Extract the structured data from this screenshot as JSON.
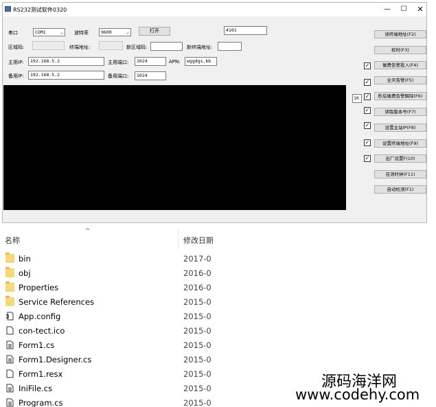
{
  "window": {
    "title": "RS232测试软件0320",
    "min_glyph": "—",
    "max_glyph": "☐",
    "close_glyph": "✕"
  },
  "form": {
    "serial_label": "串口",
    "serial_value": "COM1",
    "baud_label": "波特率",
    "baud_value": "9600",
    "open_button": "打开",
    "top_field_value": "4101",
    "zone_label": "区域码:",
    "zone_value": "",
    "terminal_label": "终端地址:",
    "terminal_value": "",
    "new_zone_label": "新区域码:",
    "new_zone_value": "",
    "new_terminal_label": "新终端地址:",
    "new_terminal_value": "",
    "main_ip_label": "主用IP:",
    "main_ip_value": "192.168.5.2",
    "main_port_label": "主用端口:",
    "main_port_value": "1024",
    "apn_label": "APN:",
    "apn_value": "wggdgs.bb",
    "backup_ip_label": "备用IP:",
    "backup_ip_value": "192.168.5.2",
    "backup_port_label": "备用端口:",
    "backup_port_value": "1024",
    "delay_value": "10"
  },
  "side_buttons": [
    {
      "label": "读终端地址(F2)",
      "checkbox": false,
      "checked": false
    },
    {
      "label": "校时(F3)",
      "checkbox": false,
      "checked": false
    },
    {
      "label": "催费告警投入(F4)",
      "checkbox": true,
      "checked": true
    },
    {
      "label": "全天告警(F5)",
      "checkbox": true,
      "checked": true
    },
    {
      "label": "秒后催费告警解除(F6)",
      "checkbox": true,
      "checked": true
    },
    {
      "label": "读取版本号(F7)",
      "checkbox": true,
      "checked": true
    },
    {
      "label": "设置主站IP(F8)",
      "checkbox": true,
      "checked": true
    },
    {
      "label": "设置终端地址(F9)",
      "checkbox": true,
      "checked": true
    },
    {
      "label": "出厂设置F(10)",
      "checkbox": true,
      "checked": true
    },
    {
      "label": "召测时钟(F11)",
      "checkbox": false,
      "checked": false
    },
    {
      "label": "自动检测(F1)",
      "checkbox": false,
      "checked": false
    }
  ],
  "explorer": {
    "sort_arrow": "^",
    "col_name": "名称",
    "col_date": "修改日期",
    "files": [
      {
        "name": "bin",
        "date": "2017-0",
        "icon": "folder-icon"
      },
      {
        "name": "obj",
        "date": "2016-0",
        "icon": "folder-icon"
      },
      {
        "name": "Properties",
        "date": "2016-0",
        "icon": "folder-icon"
      },
      {
        "name": "Service References",
        "date": "2015-0",
        "icon": "folder-icon"
      },
      {
        "name": "App.config",
        "date": "2015-0",
        "icon": "config-file-icon"
      },
      {
        "name": "con-tect.ico",
        "date": "2015-0",
        "icon": "blank-file-icon"
      },
      {
        "name": "Form1.cs",
        "date": "2015-0",
        "icon": "text-file-icon"
      },
      {
        "name": "Form1.Designer.cs",
        "date": "2015-0",
        "icon": "text-file-icon"
      },
      {
        "name": "Form1.resx",
        "date": "2015-0",
        "icon": "blank-file-icon"
      },
      {
        "name": "IniFile.cs",
        "date": "2015-0",
        "icon": "text-file-icon"
      },
      {
        "name": "Program.cs",
        "date": "2015-0",
        "icon": "text-file-icon"
      }
    ]
  },
  "watermark": {
    "line1": "源码海洋网",
    "line2": "www.codehy.com"
  }
}
